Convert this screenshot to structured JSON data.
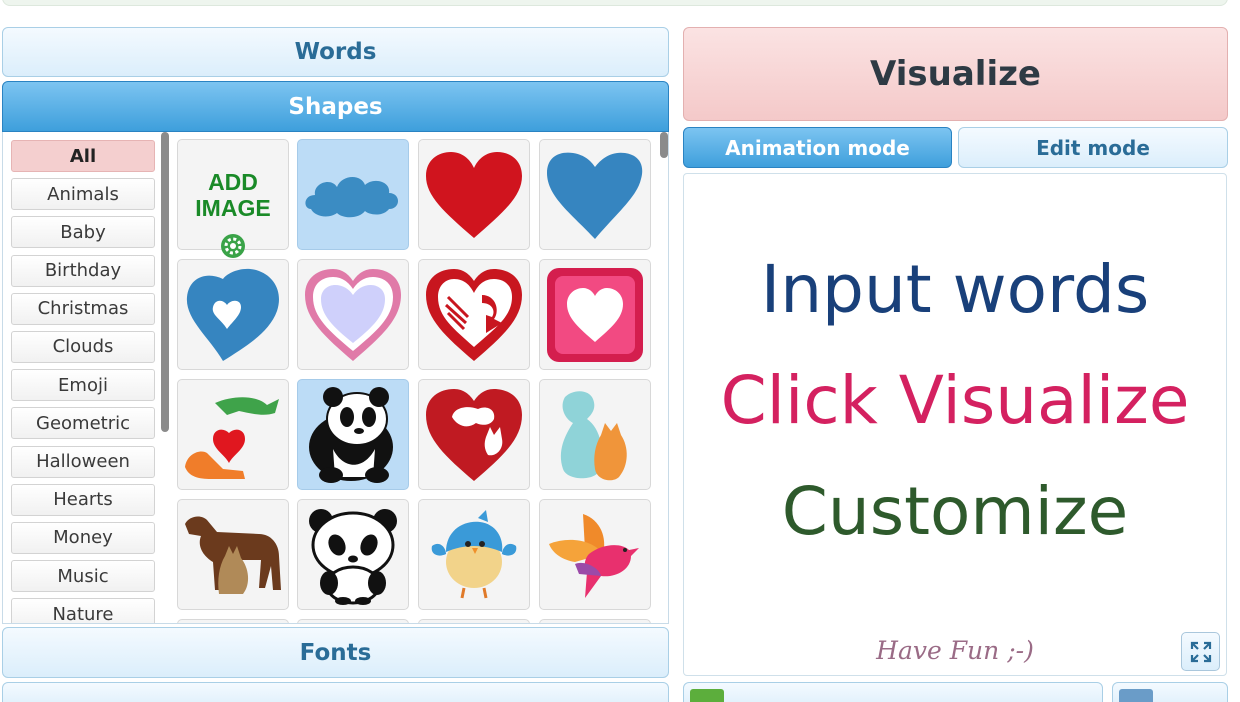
{
  "accordion": {
    "words_label": "Words",
    "shapes_label": "Shapes",
    "fonts_label": "Fonts"
  },
  "categories": [
    "All",
    "Animals",
    "Baby",
    "Birthday",
    "Christmas",
    "Clouds",
    "Emoji",
    "Geometric",
    "Halloween",
    "Hearts",
    "Money",
    "Music",
    "Nature"
  ],
  "selected_category": "All",
  "shapes_grid": {
    "add_image_line1": "ADD",
    "add_image_line2": "IMAGE",
    "tiles": [
      "add-image",
      "cloud",
      "red-heart",
      "blue-heart",
      "blue-heart-outline",
      "pink-ring-heart",
      "red-arrow-heart",
      "pink-square-heart",
      "hands-heart",
      "panda",
      "heart-cat-dog",
      "cat-dog",
      "dog-cat-silhouette",
      "cartoon-panda",
      "blue-bird",
      "orange-pink-bird"
    ],
    "selected_tiles": [
      "cloud",
      "panda"
    ]
  },
  "visualize_label": "Visualize",
  "modes": {
    "animation": "Animation mode",
    "edit": "Edit mode",
    "active": "Animation mode"
  },
  "preview": {
    "line1": "Input words",
    "line2": "Click Visualize",
    "line3": "Customize",
    "footer": "Have Fun ;-)"
  },
  "colors": {
    "accent_blue": "#3e9fdc",
    "visualize_pink": "#f4c9c9",
    "line1": "#19407a",
    "line2": "#d42160",
    "line3": "#2e5a2c",
    "add_image_green": "#1a8a28"
  }
}
